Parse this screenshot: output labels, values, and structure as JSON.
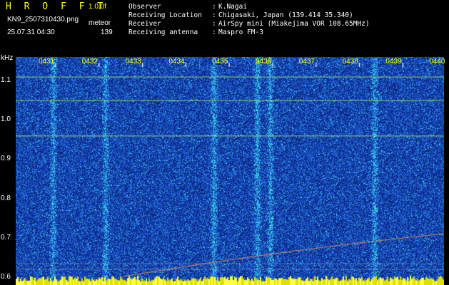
{
  "header": {
    "title": "H R O F F T",
    "version": "1.0.0f",
    "filename": "KN9_2507310430.png",
    "meteor_label": "meteor",
    "datetime": "25.07.31 04:30",
    "meteor_count": "139",
    "fields": [
      {
        "label": "Observer",
        "value": "K.Nagai"
      },
      {
        "label": "Receiving Location",
        "value": "Chigasaki, Japan (139.414 35.340)"
      },
      {
        "label": "Receiver",
        "value": "AirSpy mini (Miakejima VOR 108.65MHz)"
      },
      {
        "label": "Receiving antenna",
        "value": "Maspro FM-3"
      }
    ]
  },
  "chart_data": {
    "type": "heatmap",
    "ylabel": "kHz",
    "y_ticks": [
      "1.1",
      "1.0",
      "0.9",
      "0.8",
      "0.7",
      "0.6"
    ],
    "x_ticks": [
      "0431",
      "0432",
      "0433",
      "0434",
      "0435",
      "0436",
      "0437",
      "0438",
      "0439",
      "0440"
    ],
    "ylim": [
      0.58,
      1.16
    ],
    "horizontal_lines_khz": [
      1.11,
      1.05,
      0.96
    ],
    "vertical_streaks_min": [
      0.7,
      1.9,
      4.4,
      5.4,
      5.7,
      8.1
    ],
    "colors": {
      "background": "#0a2a8c",
      "noise_mid": "#1f6fe0",
      "noise_high": "#2ad0e0",
      "lines": "#9fe07a",
      "tick_labels": "#ffff00",
      "title": "#ffff00"
    }
  }
}
